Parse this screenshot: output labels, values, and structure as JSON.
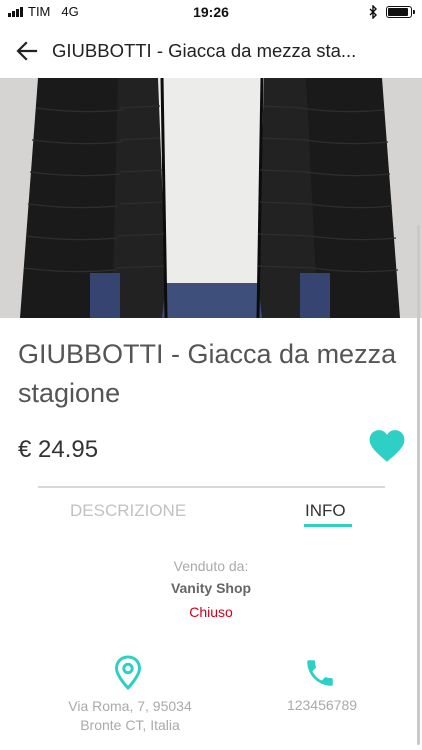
{
  "status_bar": {
    "carrier": "TIM",
    "network": "4G",
    "time": "19:26"
  },
  "header": {
    "title": "GIUBBOTTI - Giacca da mezza sta..."
  },
  "product": {
    "title": "GIUBBOTTI - Giacca da mezza stagione",
    "price": "€ 24.95",
    "favorite": true
  },
  "tabs": [
    {
      "label": "DESCRIZIONE",
      "active": false
    },
    {
      "label": "INFO",
      "active": true
    }
  ],
  "info": {
    "sold_by_label": "Venduto da:",
    "shop_name": "Vanity Shop",
    "shop_status": "Chiuso",
    "address_line1": "Via Roma, 7, 95034",
    "address_line2": "Bronte CT, Italia",
    "phone": "123456789"
  },
  "colors": {
    "accent": "#2ecfc5",
    "closed": "#d0021b"
  }
}
